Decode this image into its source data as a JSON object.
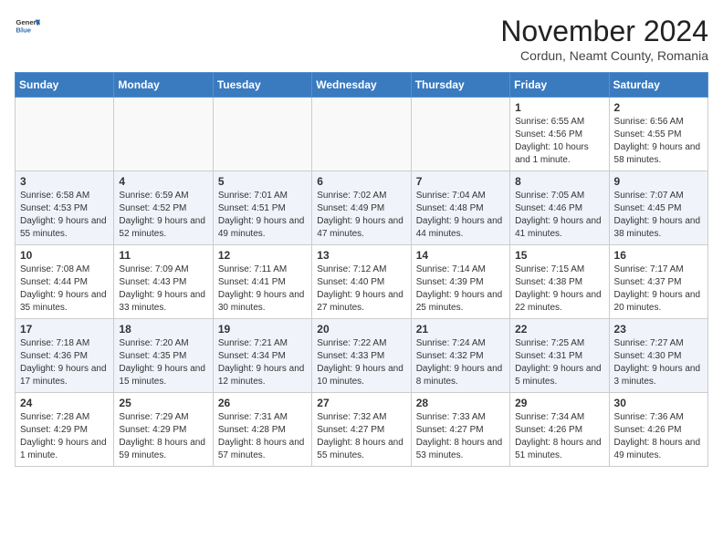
{
  "logo": {
    "general": "General",
    "blue": "Blue"
  },
  "header": {
    "month": "November 2024",
    "location": "Cordun, Neamt County, Romania"
  },
  "weekdays": [
    "Sunday",
    "Monday",
    "Tuesday",
    "Wednesday",
    "Thursday",
    "Friday",
    "Saturday"
  ],
  "weeks": [
    [
      {
        "day": "",
        "info": ""
      },
      {
        "day": "",
        "info": ""
      },
      {
        "day": "",
        "info": ""
      },
      {
        "day": "",
        "info": ""
      },
      {
        "day": "",
        "info": ""
      },
      {
        "day": "1",
        "info": "Sunrise: 6:55 AM\nSunset: 4:56 PM\nDaylight: 10 hours and 1 minute."
      },
      {
        "day": "2",
        "info": "Sunrise: 6:56 AM\nSunset: 4:55 PM\nDaylight: 9 hours and 58 minutes."
      }
    ],
    [
      {
        "day": "3",
        "info": "Sunrise: 6:58 AM\nSunset: 4:53 PM\nDaylight: 9 hours and 55 minutes."
      },
      {
        "day": "4",
        "info": "Sunrise: 6:59 AM\nSunset: 4:52 PM\nDaylight: 9 hours and 52 minutes."
      },
      {
        "day": "5",
        "info": "Sunrise: 7:01 AM\nSunset: 4:51 PM\nDaylight: 9 hours and 49 minutes."
      },
      {
        "day": "6",
        "info": "Sunrise: 7:02 AM\nSunset: 4:49 PM\nDaylight: 9 hours and 47 minutes."
      },
      {
        "day": "7",
        "info": "Sunrise: 7:04 AM\nSunset: 4:48 PM\nDaylight: 9 hours and 44 minutes."
      },
      {
        "day": "8",
        "info": "Sunrise: 7:05 AM\nSunset: 4:46 PM\nDaylight: 9 hours and 41 minutes."
      },
      {
        "day": "9",
        "info": "Sunrise: 7:07 AM\nSunset: 4:45 PM\nDaylight: 9 hours and 38 minutes."
      }
    ],
    [
      {
        "day": "10",
        "info": "Sunrise: 7:08 AM\nSunset: 4:44 PM\nDaylight: 9 hours and 35 minutes."
      },
      {
        "day": "11",
        "info": "Sunrise: 7:09 AM\nSunset: 4:43 PM\nDaylight: 9 hours and 33 minutes."
      },
      {
        "day": "12",
        "info": "Sunrise: 7:11 AM\nSunset: 4:41 PM\nDaylight: 9 hours and 30 minutes."
      },
      {
        "day": "13",
        "info": "Sunrise: 7:12 AM\nSunset: 4:40 PM\nDaylight: 9 hours and 27 minutes."
      },
      {
        "day": "14",
        "info": "Sunrise: 7:14 AM\nSunset: 4:39 PM\nDaylight: 9 hours and 25 minutes."
      },
      {
        "day": "15",
        "info": "Sunrise: 7:15 AM\nSunset: 4:38 PM\nDaylight: 9 hours and 22 minutes."
      },
      {
        "day": "16",
        "info": "Sunrise: 7:17 AM\nSunset: 4:37 PM\nDaylight: 9 hours and 20 minutes."
      }
    ],
    [
      {
        "day": "17",
        "info": "Sunrise: 7:18 AM\nSunset: 4:36 PM\nDaylight: 9 hours and 17 minutes."
      },
      {
        "day": "18",
        "info": "Sunrise: 7:20 AM\nSunset: 4:35 PM\nDaylight: 9 hours and 15 minutes."
      },
      {
        "day": "19",
        "info": "Sunrise: 7:21 AM\nSunset: 4:34 PM\nDaylight: 9 hours and 12 minutes."
      },
      {
        "day": "20",
        "info": "Sunrise: 7:22 AM\nSunset: 4:33 PM\nDaylight: 9 hours and 10 minutes."
      },
      {
        "day": "21",
        "info": "Sunrise: 7:24 AM\nSunset: 4:32 PM\nDaylight: 9 hours and 8 minutes."
      },
      {
        "day": "22",
        "info": "Sunrise: 7:25 AM\nSunset: 4:31 PM\nDaylight: 9 hours and 5 minutes."
      },
      {
        "day": "23",
        "info": "Sunrise: 7:27 AM\nSunset: 4:30 PM\nDaylight: 9 hours and 3 minutes."
      }
    ],
    [
      {
        "day": "24",
        "info": "Sunrise: 7:28 AM\nSunset: 4:29 PM\nDaylight: 9 hours and 1 minute."
      },
      {
        "day": "25",
        "info": "Sunrise: 7:29 AM\nSunset: 4:29 PM\nDaylight: 8 hours and 59 minutes."
      },
      {
        "day": "26",
        "info": "Sunrise: 7:31 AM\nSunset: 4:28 PM\nDaylight: 8 hours and 57 minutes."
      },
      {
        "day": "27",
        "info": "Sunrise: 7:32 AM\nSunset: 4:27 PM\nDaylight: 8 hours and 55 minutes."
      },
      {
        "day": "28",
        "info": "Sunrise: 7:33 AM\nSunset: 4:27 PM\nDaylight: 8 hours and 53 minutes."
      },
      {
        "day": "29",
        "info": "Sunrise: 7:34 AM\nSunset: 4:26 PM\nDaylight: 8 hours and 51 minutes."
      },
      {
        "day": "30",
        "info": "Sunrise: 7:36 AM\nSunset: 4:26 PM\nDaylight: 8 hours and 49 minutes."
      }
    ]
  ]
}
